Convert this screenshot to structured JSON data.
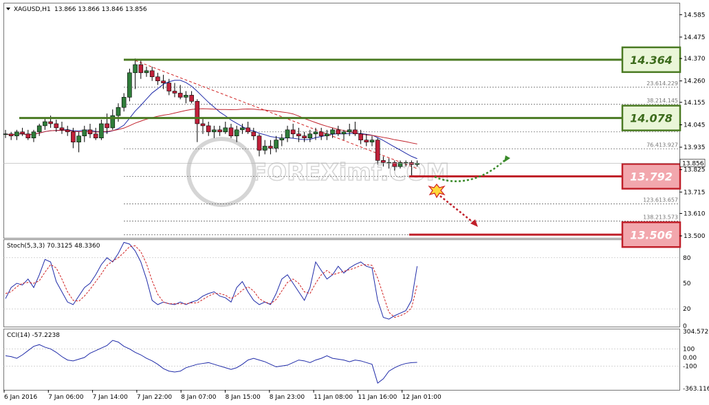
{
  "header": {
    "symbol": "XAGUSD,H1",
    "ohlc": "13.866 13.866 13.846 13.856"
  },
  "watermark": "FOREXimf.COM",
  "chart_data": {
    "type": "candlestick",
    "price_axis": {
      "ticks": [
        "14.585",
        "14.475",
        "14.370",
        "14.260",
        "14.155",
        "14.045",
        "13.935",
        "13.825",
        "13.715",
        "13.610",
        "13.500"
      ],
      "ylim": [
        13.49,
        14.64
      ],
      "current_price": "13.856"
    },
    "time_axis": {
      "labels": [
        "6 Jan 2016",
        "7 Jan 06:00",
        "7 Jan 14:00",
        "7 Jan 22:00",
        "8 Jan 07:00",
        "8 Jan 15:00",
        "8 Jan 23:00",
        "11 Jan 08:00",
        "11 Jan 16:00",
        "12 Jan 01:00"
      ]
    },
    "candles_ohlc": [
      [
        14.0,
        14.02,
        13.98,
        14.0
      ],
      [
        14.0,
        14.01,
        13.97,
        13.99
      ],
      [
        13.99,
        14.02,
        13.97,
        14.01
      ],
      [
        14.01,
        14.03,
        13.99,
        14.0
      ],
      [
        14.0,
        14.02,
        13.97,
        13.98
      ],
      [
        13.98,
        14.02,
        13.96,
        14.01
      ],
      [
        14.01,
        14.05,
        13.99,
        14.04
      ],
      [
        14.04,
        14.08,
        14.02,
        14.06
      ],
      [
        14.06,
        14.09,
        14.03,
        14.05
      ],
      [
        14.05,
        14.07,
        14.01,
        14.03
      ],
      [
        14.03,
        14.06,
        14.0,
        14.02
      ],
      [
        14.02,
        14.04,
        13.99,
        14.01
      ],
      [
        14.01,
        14.03,
        13.93,
        13.96
      ],
      [
        13.96,
        14.01,
        13.91,
        13.99
      ],
      [
        13.99,
        14.04,
        13.96,
        14.02
      ],
      [
        14.02,
        14.05,
        13.98,
        14.0
      ],
      [
        14.0,
        14.03,
        13.97,
        13.98
      ],
      [
        13.98,
        14.07,
        13.97,
        14.05
      ],
      [
        14.05,
        14.1,
        14.0,
        14.03
      ],
      [
        14.03,
        14.12,
        14.02,
        14.09
      ],
      [
        14.09,
        14.15,
        14.06,
        14.13
      ],
      [
        14.13,
        14.2,
        14.11,
        14.18
      ],
      [
        14.18,
        14.32,
        14.16,
        14.3
      ],
      [
        14.3,
        14.37,
        14.22,
        14.34
      ],
      [
        14.34,
        14.36,
        14.27,
        14.3
      ],
      [
        14.3,
        14.33,
        14.28,
        14.31
      ],
      [
        14.31,
        14.33,
        14.26,
        14.28
      ],
      [
        14.28,
        14.3,
        14.24,
        14.26
      ],
      [
        14.26,
        14.29,
        14.22,
        14.25
      ],
      [
        14.25,
        14.27,
        14.19,
        14.21
      ],
      [
        14.21,
        14.25,
        14.18,
        14.2
      ],
      [
        14.2,
        14.24,
        14.17,
        14.18
      ],
      [
        14.18,
        14.21,
        14.15,
        14.19
      ],
      [
        14.19,
        14.21,
        14.15,
        14.16
      ],
      [
        14.16,
        14.17,
        13.96,
        14.05
      ],
      [
        14.05,
        14.08,
        14.0,
        14.04
      ],
      [
        14.04,
        14.06,
        13.99,
        14.01
      ],
      [
        14.01,
        14.04,
        13.98,
        14.02
      ],
      [
        14.02,
        14.04,
        13.99,
        14.01
      ],
      [
        14.01,
        14.06,
        14.0,
        14.03
      ],
      [
        14.03,
        14.05,
        13.98,
        13.99
      ],
      [
        13.99,
        14.04,
        13.96,
        14.02
      ],
      [
        14.02,
        14.05,
        14.0,
        14.03
      ],
      [
        14.03,
        14.06,
        14.0,
        14.01
      ],
      [
        14.01,
        14.03,
        13.97,
        13.99
      ],
      [
        13.99,
        14.0,
        13.89,
        13.92
      ],
      [
        13.92,
        13.97,
        13.9,
        13.94
      ],
      [
        13.94,
        13.97,
        13.9,
        13.93
      ],
      [
        13.93,
        13.99,
        13.91,
        13.97
      ],
      [
        13.97,
        14.0,
        13.94,
        13.98
      ],
      [
        13.98,
        14.04,
        13.96,
        14.02
      ],
      [
        14.02,
        14.05,
        13.98,
        14.0
      ],
      [
        14.0,
        14.03,
        13.96,
        13.99
      ],
      [
        13.99,
        14.01,
        13.96,
        13.98
      ],
      [
        13.98,
        14.02,
        13.96,
        14.0
      ],
      [
        14.0,
        14.03,
        13.97,
        14.01
      ],
      [
        14.01,
        14.03,
        13.97,
        13.99
      ],
      [
        13.99,
        14.02,
        13.97,
        14.0
      ],
      [
        14.0,
        14.03,
        13.98,
        14.02
      ],
      [
        14.02,
        14.04,
        13.99,
        14.0
      ],
      [
        14.0,
        14.02,
        13.97,
        14.01
      ],
      [
        14.01,
        14.05,
        13.99,
        14.02
      ],
      [
        14.02,
        14.06,
        13.99,
        14.0
      ],
      [
        14.0,
        14.02,
        13.95,
        13.97
      ],
      [
        13.97,
        14.0,
        13.94,
        13.96
      ],
      [
        13.96,
        13.99,
        13.94,
        13.97
      ],
      [
        13.97,
        13.98,
        13.85,
        13.87
      ],
      [
        13.87,
        13.89,
        13.84,
        13.86
      ],
      [
        13.86,
        13.88,
        13.83,
        13.86
      ],
      [
        13.86,
        13.87,
        13.82,
        13.84
      ],
      [
        13.84,
        13.87,
        13.83,
        13.86
      ],
      [
        13.86,
        13.87,
        13.84,
        13.86
      ],
      [
        13.86,
        13.87,
        13.79,
        13.85
      ],
      [
        13.85,
        13.87,
        13.84,
        13.856
      ]
    ],
    "levels": [
      {
        "label": "14.364",
        "value": 14.364,
        "kind": "resistance",
        "color": "#4a7a22"
      },
      {
        "label": "14.078",
        "value": 14.078,
        "kind": "resistance",
        "color": "#4a7a22"
      },
      {
        "label": "13.792",
        "value": 13.792,
        "kind": "support",
        "color": "#c0202a"
      },
      {
        "label": "13.506",
        "value": 13.506,
        "kind": "support",
        "color": "#c0202a"
      }
    ],
    "fib_levels": [
      {
        "ratio": "23.6",
        "price": "14.229"
      },
      {
        "ratio": "38.2",
        "price": "14.145"
      },
      {
        "ratio": "",
        "price": "14.010"
      },
      {
        "ratio": "76.4",
        "price": "13.927"
      },
      {
        "ratio": "",
        "price": "13.792"
      },
      {
        "ratio": "123.6",
        "price": "13.657"
      },
      {
        "ratio": "138.2",
        "price": "13.573"
      },
      {
        "ratio": "",
        "price": "13.506"
      }
    ],
    "stochastic": {
      "label": "Stoch(5,3,3) 70.3125 48.3360",
      "ticks": [
        "80",
        "50",
        "20",
        "0"
      ],
      "ylim": [
        0,
        100
      ],
      "main": [
        32,
        45,
        50,
        48,
        55,
        45,
        60,
        78,
        75,
        52,
        40,
        28,
        25,
        35,
        45,
        50,
        60,
        72,
        80,
        75,
        85,
        98,
        96,
        88,
        75,
        55,
        30,
        25,
        28,
        26,
        25,
        28,
        25,
        28,
        30,
        35,
        38,
        40,
        35,
        33,
        28,
        45,
        52,
        40,
        30,
        25,
        28,
        25,
        38,
        55,
        60,
        50,
        40,
        30,
        45,
        75,
        65,
        55,
        60,
        70,
        62,
        68,
        72,
        75,
        70,
        68,
        30,
        10,
        8,
        12,
        15,
        18,
        30,
        70
      ],
      "signal": [
        38,
        40,
        46,
        50,
        51,
        50,
        53,
        63,
        72,
        68,
        55,
        40,
        30,
        29,
        35,
        43,
        52,
        61,
        71,
        76,
        80,
        86,
        93,
        94,
        87,
        73,
        53,
        37,
        28,
        26,
        26,
        26,
        26,
        27,
        27,
        31,
        35,
        38,
        38,
        36,
        32,
        36,
        42,
        46,
        41,
        32,
        28,
        26,
        31,
        41,
        51,
        55,
        50,
        40,
        38,
        50,
        60,
        65,
        60,
        62,
        64,
        66,
        68,
        71,
        72,
        71,
        56,
        36,
        16,
        10,
        12,
        15,
        21,
        48
      ]
    },
    "cci": {
      "label": "CCI(14) -57.2238",
      "ticks": [
        "304.5726",
        "100",
        "0.00",
        "-100",
        "-363.1167"
      ],
      "ylim": [
        -363.1167,
        304.5726
      ],
      "values": [
        20,
        10,
        -10,
        30,
        80,
        130,
        150,
        120,
        100,
        60,
        10,
        -30,
        -40,
        -20,
        0,
        50,
        80,
        110,
        140,
        200,
        180,
        130,
        100,
        60,
        30,
        -10,
        -40,
        -80,
        -130,
        -160,
        -170,
        -160,
        -120,
        -100,
        -80,
        -70,
        -60,
        -80,
        -100,
        -120,
        -140,
        -120,
        -80,
        -30,
        -10,
        -30,
        -50,
        -80,
        -110,
        -100,
        -90,
        -60,
        -30,
        -40,
        -60,
        -30,
        -10,
        20,
        -10,
        -20,
        -30,
        -50,
        -30,
        -40,
        -60,
        -80,
        -300,
        -250,
        -160,
        -120,
        -90,
        -70,
        -60,
        -57
      ]
    },
    "grid": false
  }
}
